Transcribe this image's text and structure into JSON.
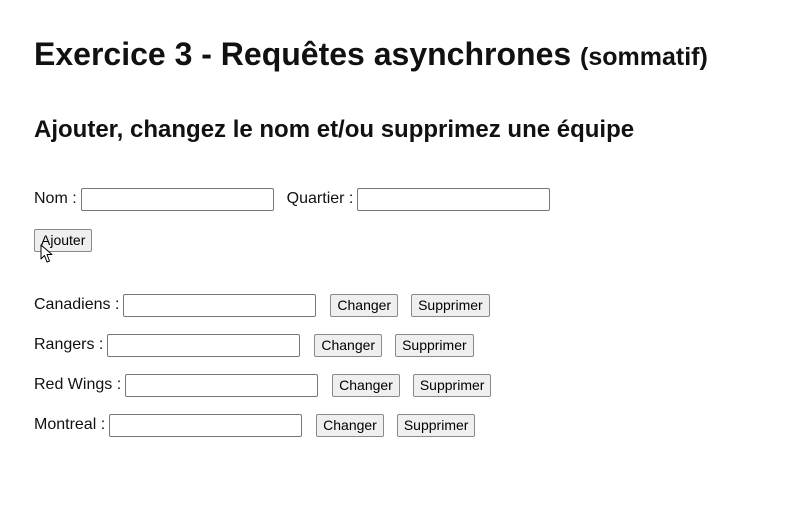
{
  "heading": {
    "title": "Exercice 3 - Requêtes asynchrones",
    "subtitle_tag": "(sommatif)"
  },
  "section": {
    "title": "Ajouter, changez le nom et/ou supprimez une équipe"
  },
  "add_form": {
    "nom_label": "Nom :",
    "nom_value": "",
    "quartier_label": "Quartier :",
    "quartier_value": "",
    "add_button": "Ajouter"
  },
  "teams": [
    {
      "label": "Canadiens :",
      "value": "",
      "change_button": "Changer",
      "delete_button": "Supprimer"
    },
    {
      "label": "Rangers :",
      "value": "",
      "change_button": "Changer",
      "delete_button": "Supprimer"
    },
    {
      "label": "Red Wings :",
      "value": "",
      "change_button": "Changer",
      "delete_button": "Supprimer"
    },
    {
      "label": "Montreal :",
      "value": "",
      "change_button": "Changer",
      "delete_button": "Supprimer"
    }
  ],
  "icons": {
    "cursor": "mouse-pointer-icon"
  }
}
